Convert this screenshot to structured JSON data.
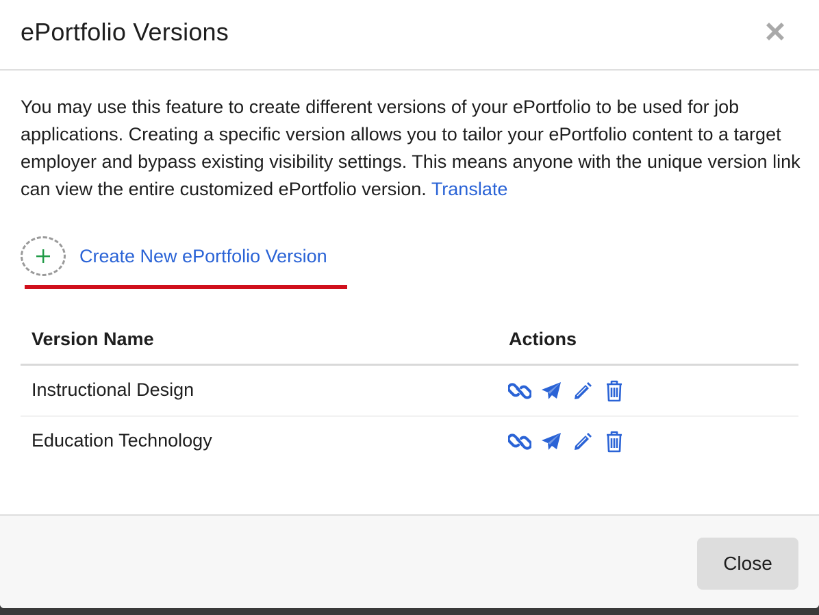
{
  "modal": {
    "title": "ePortfolio Versions",
    "close_icon": "close-x-icon"
  },
  "description": {
    "text": "You may use this feature to create different versions of your ePortfolio to be used for job applications. Creating a specific version allows you to tailor your ePortfolio content to a target employer and bypass existing visibility settings. This means anyone with the unique version link can view the entire customized ePortfolio version.",
    "translate_label": "Translate"
  },
  "create": {
    "label": "Create New ePortfolio Version",
    "icon": "plus-icon"
  },
  "table": {
    "headers": {
      "name": "Version Name",
      "actions": "Actions"
    },
    "rows": [
      {
        "name": "Instructional Design"
      },
      {
        "name": "Education Technology"
      }
    ],
    "action_icons": [
      "link-icon",
      "send-icon",
      "edit-pencil-icon",
      "trash-icon"
    ]
  },
  "footer": {
    "close_label": "Close"
  },
  "colors": {
    "link": "#2a63d6",
    "plus": "#1f9a45",
    "highlight_underline": "#d0101c",
    "close_button_bg": "#dddddd"
  }
}
